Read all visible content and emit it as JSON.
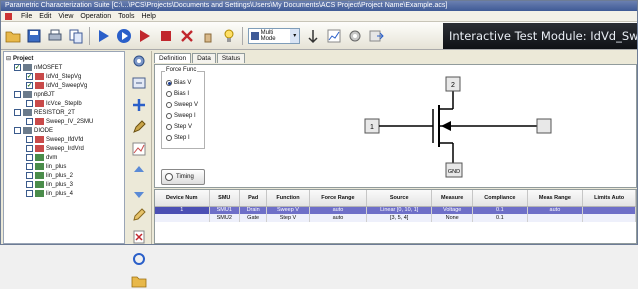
{
  "window": {
    "title": "Parametric Characterization Suite [C:\\...\\PCS\\Projects\\Documents and Settings\\Users\\My Documents\\ACS Project\\Project Name\\Example.acs]"
  },
  "menu": [
    "File",
    "Edit",
    "View",
    "Operation",
    "Tools",
    "Help"
  ],
  "toolbar": {
    "mode_label": "Multi Mode",
    "module_title": "Interactive Test Module: IdVd_SweepVg"
  },
  "tree": {
    "items": [
      {
        "label": "Project",
        "checked": false
      },
      {
        "label": "nMOSFET",
        "checked": true
      },
      {
        "label": "IdVd_StepVg",
        "checked": true
      },
      {
        "label": "IdVd_SweepVg",
        "checked": true
      },
      {
        "label": "npnBJT",
        "checked": false
      },
      {
        "label": "IcVce_StepIb",
        "checked": false
      },
      {
        "label": "RESISTOR_2T",
        "checked": false
      },
      {
        "label": "Sweep_IV_2SMU",
        "checked": false
      },
      {
        "label": "DIODE",
        "checked": false
      },
      {
        "label": "Sweep_IfdVfd",
        "checked": false
      },
      {
        "label": "Sweep_IrdVrd",
        "checked": false
      },
      {
        "label": "dvm",
        "checked": false
      },
      {
        "label": "lin_plus",
        "checked": false
      },
      {
        "label": "lin_plus_2",
        "checked": false
      },
      {
        "label": "lin_plus_3",
        "checked": false
      },
      {
        "label": "lin_plus_4",
        "checked": false
      }
    ]
  },
  "tabs": [
    "Definition",
    "Data",
    "Status"
  ],
  "force_func": {
    "legend": "Force Func",
    "options": [
      "Bias V",
      "Bias I",
      "Sweep V",
      "Sweep I",
      "Step V",
      "Step I"
    ],
    "selected": "Bias V"
  },
  "timing_label": "Timing",
  "schematic": {
    "gate_terminal": "1",
    "drain_terminal": "2",
    "source_terminal": "GND"
  },
  "table": {
    "headers": [
      "Device Num",
      "SMU",
      "Pad",
      "Function",
      "Force Range",
      "Source",
      "Measure",
      "Compliance",
      "Meas Range",
      "Limits Auto"
    ],
    "rows": [
      {
        "num": "1",
        "cells": [
          "SMU1",
          "Drain",
          "Sweep V",
          "auto",
          "Linear [0, 10, 1]",
          "Voltage",
          "0.1",
          "auto",
          ""
        ],
        "selected": true
      },
      {
        "num": "",
        "cells": [
          "SMU2",
          "Gate",
          "Step V",
          "auto",
          "[3, 5, 4]",
          "None",
          "0.1",
          "",
          ""
        ],
        "selected": false
      }
    ]
  }
}
